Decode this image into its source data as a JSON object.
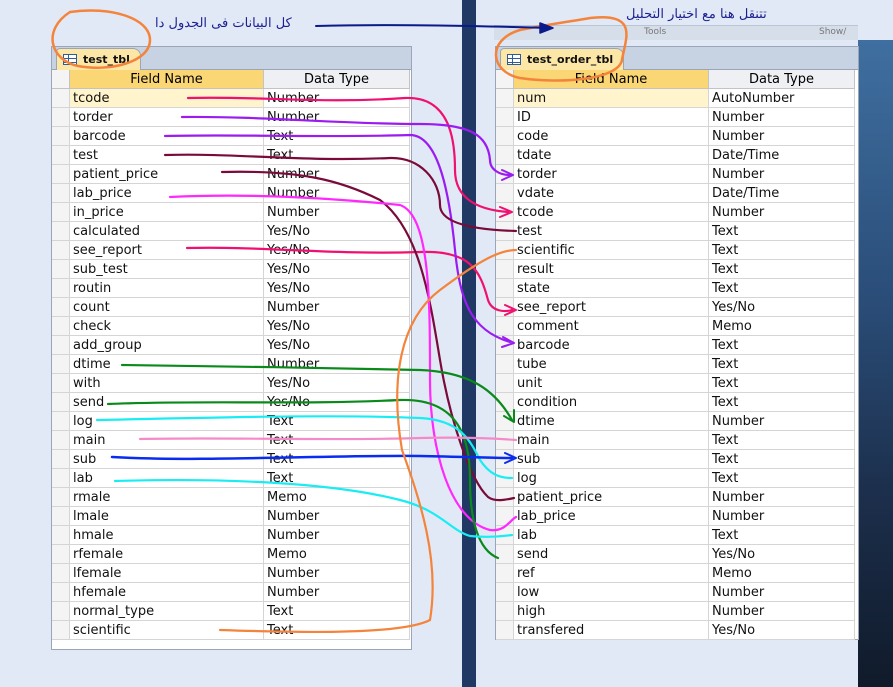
{
  "notes": {
    "left": "كل البيانات  فى الجدول دا",
    "right": "تتنقل هنا مع اختيار التحليل"
  },
  "partial_header": {
    "left_text": "Tools",
    "right_text": "Show/"
  },
  "left_table": {
    "tab_label": "test_tbl",
    "col_field": "Field Name",
    "col_type": "Data Type",
    "rows": [
      {
        "field": "tcode",
        "type": "Number"
      },
      {
        "field": "torder",
        "type": "Number"
      },
      {
        "field": "barcode",
        "type": "Text"
      },
      {
        "field": "test",
        "type": "Text"
      },
      {
        "field": "patient_price",
        "type": "Number"
      },
      {
        "field": "lab_price",
        "type": "Number"
      },
      {
        "field": "in_price",
        "type": "Number"
      },
      {
        "field": "calculated",
        "type": "Yes/No"
      },
      {
        "field": "see_report",
        "type": "Yes/No"
      },
      {
        "field": "sub_test",
        "type": "Yes/No"
      },
      {
        "field": "routin",
        "type": "Yes/No"
      },
      {
        "field": "count",
        "type": "Number"
      },
      {
        "field": "check",
        "type": "Yes/No"
      },
      {
        "field": "add_group",
        "type": "Yes/No"
      },
      {
        "field": "dtime",
        "type": "Number"
      },
      {
        "field": "with",
        "type": "Yes/No"
      },
      {
        "field": "send",
        "type": "Yes/No"
      },
      {
        "field": "log",
        "type": "Text"
      },
      {
        "field": "main",
        "type": "Text"
      },
      {
        "field": "sub",
        "type": "Text"
      },
      {
        "field": "lab",
        "type": "Text"
      },
      {
        "field": "rmale",
        "type": "Memo"
      },
      {
        "field": "lmale",
        "type": "Number"
      },
      {
        "field": "hmale",
        "type": "Number"
      },
      {
        "field": "rfemale",
        "type": "Memo"
      },
      {
        "field": "lfemale",
        "type": "Number"
      },
      {
        "field": "hfemale",
        "type": "Number"
      },
      {
        "field": "normal_type",
        "type": "Text"
      },
      {
        "field": "scientific",
        "type": "Text"
      }
    ]
  },
  "right_table": {
    "tab_label": "test_order_tbl",
    "col_field": "Field Name",
    "col_type": "Data Type",
    "rows": [
      {
        "field": "num",
        "type": "AutoNumber"
      },
      {
        "field": "ID",
        "type": "Number"
      },
      {
        "field": "code",
        "type": "Number"
      },
      {
        "field": "tdate",
        "type": "Date/Time"
      },
      {
        "field": "torder",
        "type": "Number"
      },
      {
        "field": "vdate",
        "type": "Date/Time"
      },
      {
        "field": "tcode",
        "type": "Number"
      },
      {
        "field": "test",
        "type": "Text"
      },
      {
        "field": "scientific",
        "type": "Text"
      },
      {
        "field": "result",
        "type": "Text"
      },
      {
        "field": "state",
        "type": "Text"
      },
      {
        "field": "see_report",
        "type": "Yes/No"
      },
      {
        "field": "comment",
        "type": "Memo"
      },
      {
        "field": "barcode",
        "type": "Text"
      },
      {
        "field": "tube",
        "type": "Text"
      },
      {
        "field": "unit",
        "type": "Text"
      },
      {
        "field": "condition",
        "type": "Text"
      },
      {
        "field": "dtime",
        "type": "Number"
      },
      {
        "field": "main",
        "type": "Text"
      },
      {
        "field": "sub",
        "type": "Text"
      },
      {
        "field": "log",
        "type": "Text"
      },
      {
        "field": "patient_price",
        "type": "Number"
      },
      {
        "field": "lab_price",
        "type": "Number"
      },
      {
        "field": "lab",
        "type": "Text"
      },
      {
        "field": "send",
        "type": "Yes/No"
      },
      {
        "field": "ref",
        "type": "Memo"
      },
      {
        "field": "low",
        "type": "Number"
      },
      {
        "field": "high",
        "type": "Number"
      },
      {
        "field": "transfered",
        "type": "Yes/No"
      }
    ]
  },
  "colors": {
    "red": "#f01070",
    "purple": "#9b1bf0",
    "maroon": "#7a0a3a",
    "magenta": "#ff28ff",
    "green": "#0a8a1a",
    "cyan": "#19ecf2",
    "pink": "#f58ac8",
    "blue": "#0a2cf0",
    "orange": "#f4843c",
    "navy": "#0a1a8a"
  }
}
